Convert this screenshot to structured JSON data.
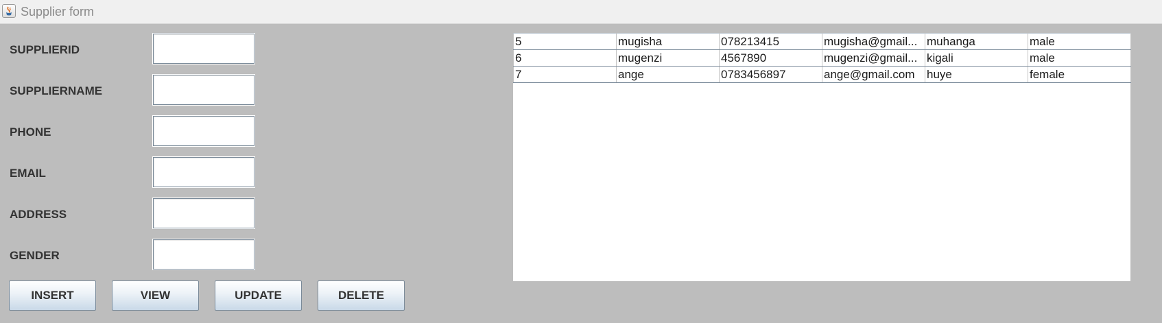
{
  "window": {
    "title": "Supplier form",
    "icon": "java-icon"
  },
  "form": {
    "fields": [
      {
        "key": "supplierid",
        "label": "SUPPLIERID",
        "value": ""
      },
      {
        "key": "suppliername",
        "label": "SUPPLIERNAME",
        "value": ""
      },
      {
        "key": "phone",
        "label": "PHONE",
        "value": ""
      },
      {
        "key": "email",
        "label": "EMAIL",
        "value": ""
      },
      {
        "key": "address",
        "label": "ADDRESS",
        "value": ""
      },
      {
        "key": "gender",
        "label": "GENDER",
        "value": ""
      }
    ]
  },
  "buttons": {
    "insert": "INSERT",
    "view": "VIEW",
    "update": "UPDATE",
    "delete": "DELETE"
  },
  "table": {
    "rows": [
      [
        "5",
        "mugisha",
        "078213415",
        "mugisha@gmail...",
        "muhanga",
        "male"
      ],
      [
        "6",
        "mugenzi",
        "4567890",
        "mugenzi@gmail...",
        "kigali",
        "male"
      ],
      [
        "7",
        "ange",
        "0783456897",
        "ange@gmail.com",
        "huye",
        "female"
      ]
    ]
  },
  "colors": {
    "background": "#bdbdbd",
    "button_gradient_bottom": "#c9d9e8",
    "border": "#7a8a99"
  }
}
